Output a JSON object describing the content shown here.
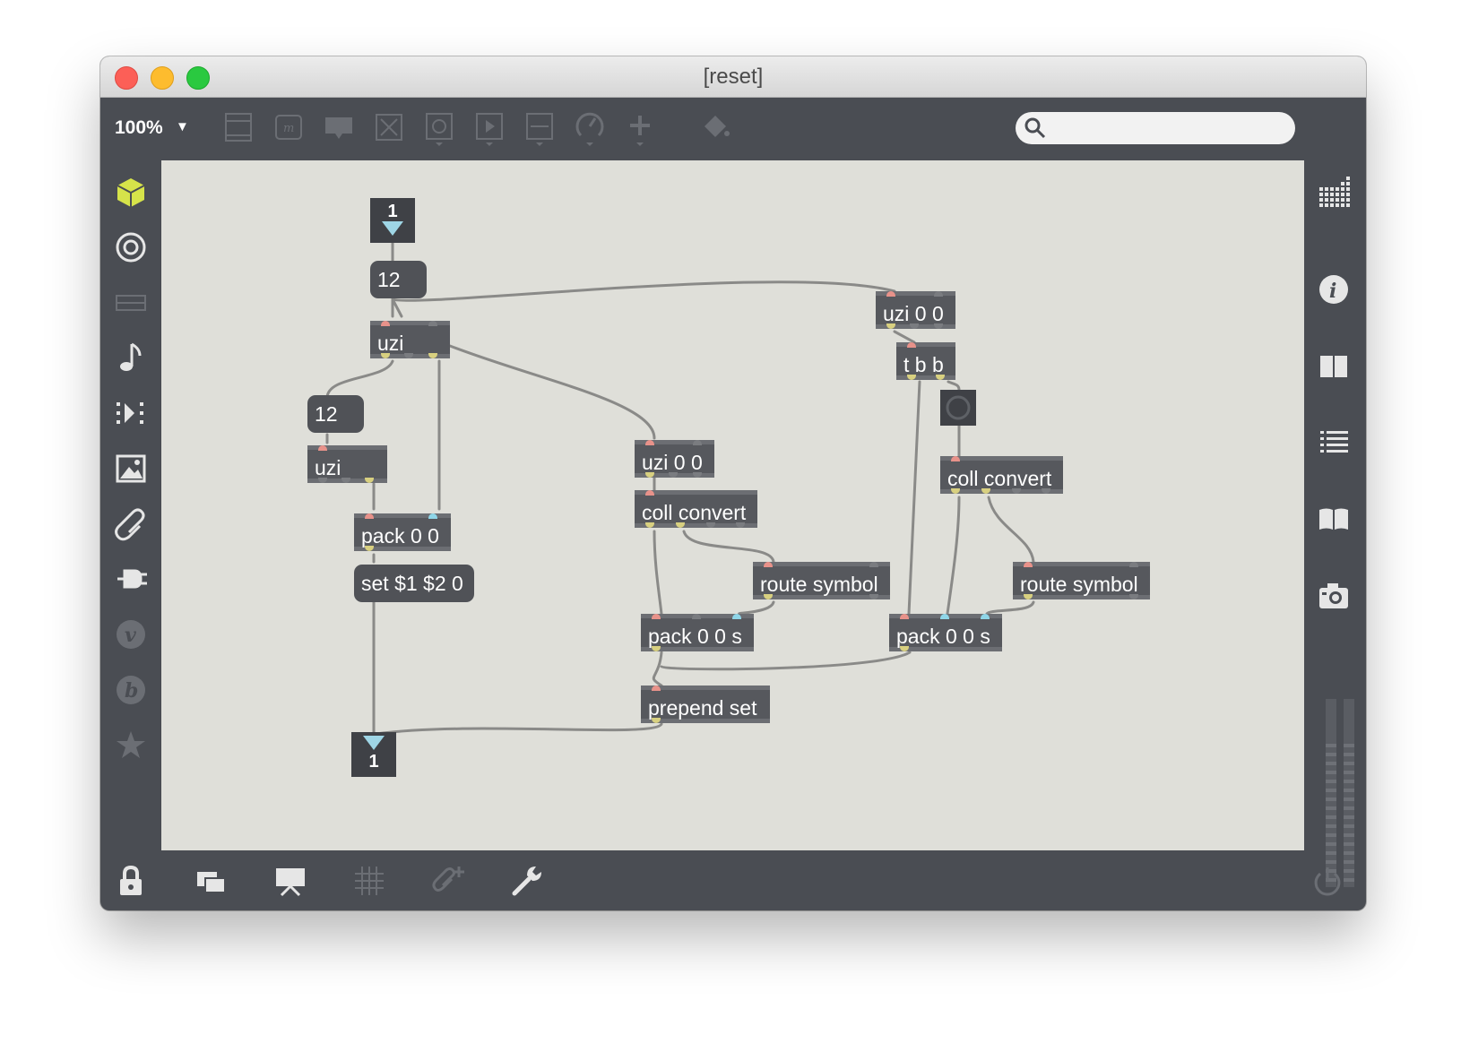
{
  "window": {
    "title": "[reset]"
  },
  "toolbar": {
    "zoom": "100%",
    "tools": [
      "object-icon",
      "message-icon",
      "comment-icon",
      "toggle-icon",
      "button-icon",
      "playbar-icon",
      "slider-icon",
      "dial-icon",
      "plus-icon",
      "paint-bucket-icon"
    ]
  },
  "search": {
    "placeholder": ""
  },
  "left_sidebar": [
    "packages-cube-icon",
    "target-icon",
    "keyboard-icon",
    "music-note-icon",
    "step-icon",
    "image-icon",
    "paperclip-icon",
    "plug-icon",
    "v-icon",
    "b-icon",
    "star-icon"
  ],
  "right_sidebar": [
    "grid-icon",
    "info-icon",
    "columns-icon",
    "list-icon",
    "book-icon",
    "camera-icon",
    "level-meter"
  ],
  "patch": {
    "inlet": {
      "label": "1"
    },
    "outlet": {
      "label": "1"
    },
    "objects": {
      "msg12a": "12",
      "uziA": "uzi",
      "msg12b": "12",
      "uziB": "uzi",
      "pack00": "pack 0 0",
      "setmsg": "set $1 $2 0",
      "uzi00a": "uzi 0 0",
      "collA": "coll convert",
      "routeA": "route symbol",
      "pack00sA": "pack 0 0 s",
      "prepend": "prepend set",
      "uzi00b": "uzi 0 0",
      "tbb": "t b b",
      "collB": "coll convert",
      "routeB": "route symbol",
      "pack00sB": "pack 0 0 s"
    }
  },
  "bottom_toolbar": [
    "lock-icon",
    "windows-icon",
    "presentation-icon",
    "grid-toggle-icon",
    "add-attachment-icon",
    "wrench-icon",
    "power-icon"
  ],
  "colors": {
    "canvas": "#dfdfd9",
    "chrome": "#4a4d53",
    "object": "#56585d",
    "cable": "#8a8a88",
    "accent_cube": "#d6e34a"
  }
}
